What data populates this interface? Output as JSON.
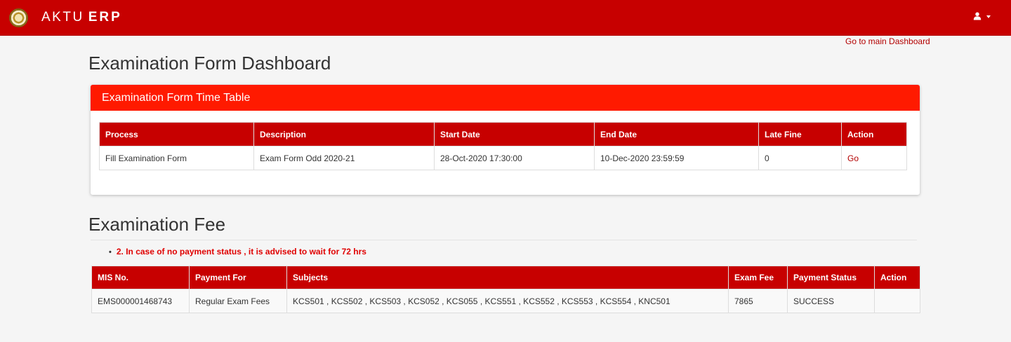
{
  "brand": {
    "prefix": "AKTU",
    "suffix": "ERP"
  },
  "nav": {
    "main_dashboard_link": "Go to main Dashboard"
  },
  "page_title": "Examination Form Dashboard",
  "timetable": {
    "heading": "Examination Form Time Table",
    "columns": [
      "Process",
      "Description",
      "Start Date",
      "End Date",
      "Late Fine",
      "Action"
    ],
    "rows": [
      {
        "process": "Fill Examination Form",
        "description": "Exam Form Odd 2020-21",
        "start_date": "28-Oct-2020 17:30:00",
        "end_date": "10-Dec-2020 23:59:59",
        "late_fine": "0",
        "action": "Go"
      }
    ]
  },
  "fee": {
    "title": "Examination Fee",
    "note": "2. In case of no payment status , it is advised to wait for 72 hrs",
    "columns": [
      "MIS No.",
      "Payment For",
      "Subjects",
      "Exam Fee",
      "Payment Status",
      "Action"
    ],
    "rows": [
      {
        "mis_no": "EMS000001468743",
        "payment_for": "Regular Exam Fees",
        "subjects": "KCS501 , KCS502 , KCS503 , KCS052 , KCS055 , KCS551 , KCS552 , KCS553 , KCS554 , KNC501",
        "exam_fee": "7865",
        "payment_status": "SUCCESS",
        "action": ""
      }
    ]
  },
  "icons": {
    "logo": "university-seal-logo",
    "user": "user-icon",
    "caret": "caret-down-icon"
  },
  "colors": {
    "navbar": "#c70000",
    "panel_heading": "#ff1a00",
    "table_header": "#c70000",
    "note": "#e00000",
    "link": "#b30000"
  }
}
